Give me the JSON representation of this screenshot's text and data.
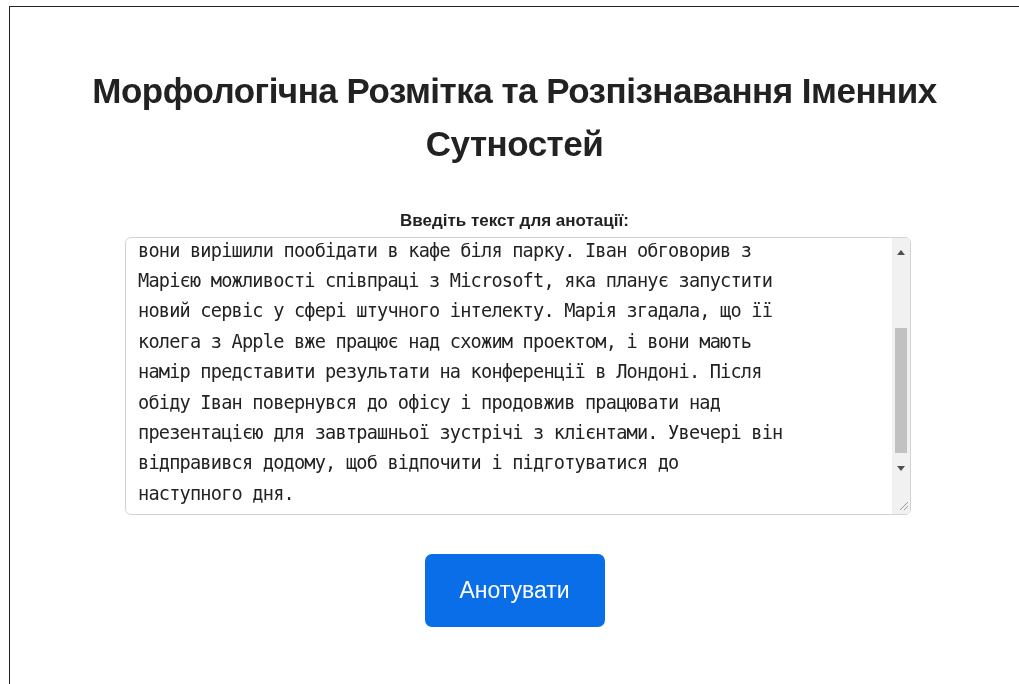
{
  "title": "Морфологічна Розмітка та Розпізнавання Іменних Сутностей",
  "input": {
    "label": "Введіть текст для анотації:",
    "visible_lines": [
      "вони вирішили пообідати в кафе біля парку. Іван обговорив з",
      "Марією можливості співпраці з Microsoft, яка планує запустити",
      "новий сервіс у сфері штучного інтелекту. Марія згадала, що її",
      "колега з Apple вже працює над схожим проектом, і вони мають",
      "намір представити результати на конференції в Лондоні. Після",
      "обіду Іван повернувся до офісу і продовжив працювати над",
      "презентацією для завтрашньої зустрічі з клієнтами. Увечері він",
      "відправився додому, щоб відпочити і підготуватися до",
      "наступного дня."
    ]
  },
  "button": "Анотувати"
}
